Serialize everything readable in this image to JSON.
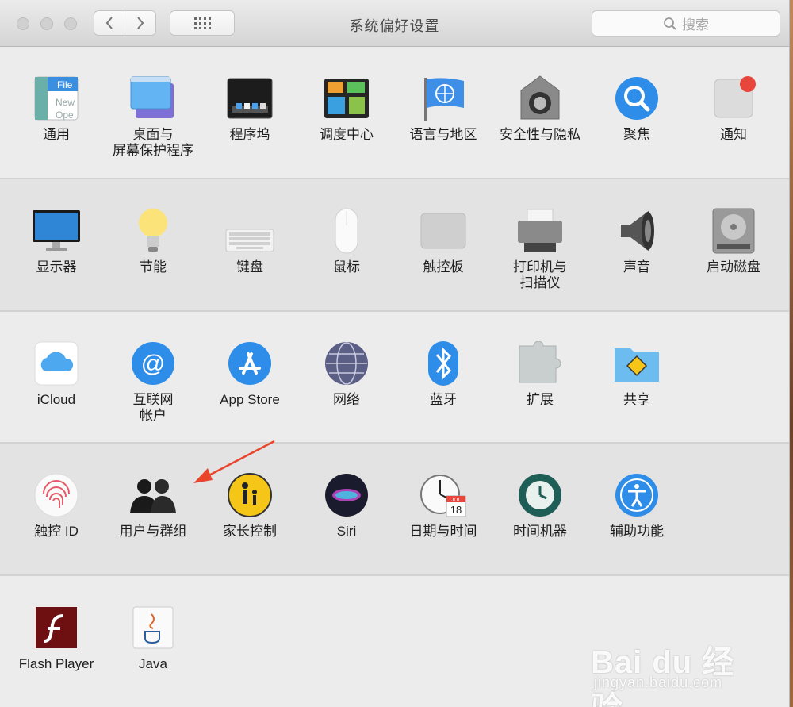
{
  "window": {
    "title": "系统偏好设置",
    "search_placeholder": "搜索",
    "back_icon": "chevron-left-icon",
    "forward_icon": "chevron-right-icon",
    "grid_icon": "show-all-grid-icon"
  },
  "rows": [
    {
      "items": [
        {
          "id": "general",
          "label": "通用",
          "icon": "general-icon"
        },
        {
          "id": "desktop",
          "label": "桌面与\n屏幕保护程序",
          "icon": "desktop-screensaver-icon"
        },
        {
          "id": "dock",
          "label": "程序坞",
          "icon": "dock-icon"
        },
        {
          "id": "mission",
          "label": "调度中心",
          "icon": "mission-control-icon"
        },
        {
          "id": "language",
          "label": "语言与地区",
          "icon": "language-region-icon"
        },
        {
          "id": "security",
          "label": "安全性与隐私",
          "icon": "security-privacy-icon"
        },
        {
          "id": "spotlight",
          "label": "聚焦",
          "icon": "spotlight-icon"
        },
        {
          "id": "notifications",
          "label": "通知",
          "icon": "notifications-icon"
        }
      ]
    },
    {
      "items": [
        {
          "id": "displays",
          "label": "显示器",
          "icon": "displays-icon"
        },
        {
          "id": "energy",
          "label": "节能",
          "icon": "energy-saver-icon"
        },
        {
          "id": "keyboard",
          "label": "键盘",
          "icon": "keyboard-icon"
        },
        {
          "id": "mouse",
          "label": "鼠标",
          "icon": "mouse-icon"
        },
        {
          "id": "trackpad",
          "label": "触控板",
          "icon": "trackpad-icon"
        },
        {
          "id": "printers",
          "label": "打印机与\n扫描仪",
          "icon": "printers-scanners-icon"
        },
        {
          "id": "sound",
          "label": "声音",
          "icon": "sound-icon"
        },
        {
          "id": "startup",
          "label": "启动磁盘",
          "icon": "startup-disk-icon"
        }
      ]
    },
    {
      "items": [
        {
          "id": "icloud",
          "label": "iCloud",
          "icon": "icloud-icon"
        },
        {
          "id": "internet",
          "label": "互联网\n帐户",
          "icon": "internet-accounts-icon"
        },
        {
          "id": "appstore",
          "label": "App Store",
          "icon": "app-store-icon"
        },
        {
          "id": "network",
          "label": "网络",
          "icon": "network-icon"
        },
        {
          "id": "bluetooth",
          "label": "蓝牙",
          "icon": "bluetooth-icon"
        },
        {
          "id": "extensions",
          "label": "扩展",
          "icon": "extensions-icon"
        },
        {
          "id": "sharing",
          "label": "共享",
          "icon": "sharing-icon"
        }
      ]
    },
    {
      "items": [
        {
          "id": "touchid",
          "label": "触控 ID",
          "icon": "touch-id-icon"
        },
        {
          "id": "users",
          "label": "用户与群组",
          "icon": "users-groups-icon"
        },
        {
          "id": "parental",
          "label": "家长控制",
          "icon": "parental-controls-icon"
        },
        {
          "id": "siri",
          "label": "Siri",
          "icon": "siri-icon"
        },
        {
          "id": "datetime",
          "label": "日期与时间",
          "icon": "date-time-icon"
        },
        {
          "id": "timemachine",
          "label": "时间机器",
          "icon": "time-machine-icon"
        },
        {
          "id": "accessibility",
          "label": "辅助功能",
          "icon": "accessibility-icon"
        }
      ]
    },
    {
      "items": [
        {
          "id": "flash",
          "label": "Flash Player",
          "icon": "flash-player-icon"
        },
        {
          "id": "java",
          "label": "Java",
          "icon": "java-icon"
        }
      ]
    }
  ],
  "icon_text": {
    "general_file": "File",
    "general_new": "New",
    "general_open": "Ope",
    "calendar_month": "JUL",
    "calendar_day": "18"
  },
  "annotation": {
    "arrow_color": "#e8452c",
    "target": "users-groups"
  },
  "watermark": {
    "brand": "Bai du 经验",
    "url": "jingyan.baidu.com"
  }
}
